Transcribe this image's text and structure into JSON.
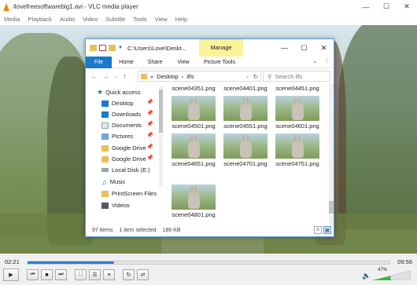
{
  "vlc": {
    "title": "ilovefreesoftwarebig1.avi - VLC media player",
    "menu": [
      "Media",
      "Playback",
      "Audio",
      "Video",
      "Subtitle",
      "Tools",
      "View",
      "Help"
    ],
    "time_elapsed": "02:21",
    "time_total": "09:56",
    "progress": 0.24,
    "volume_label": "47%",
    "volume": 0.47,
    "accent": "#2a7fd4"
  },
  "explorer": {
    "path": "C:\\Users\\Love\\Deskt...",
    "manage_tab": "Manage",
    "ribbon_tabs": [
      "File",
      "Home",
      "Share",
      "View",
      "Picture Tools"
    ],
    "breadcrumb": [
      "«",
      "Desktop",
      "›",
      "ilfs"
    ],
    "search_placeholder": "Search ilfs",
    "nav": {
      "quick_access": "Quick access",
      "items": [
        "Desktop",
        "Downloads",
        "Documents",
        "Pictures",
        "Google Drive",
        "Google Drive",
        "Local Disk (E:)",
        "Music",
        "PrintScreen Files",
        "Videos"
      ]
    },
    "files": {
      "top_row": [
        "scene04351.png",
        "scene04401.png",
        "scene04451.png"
      ],
      "row1": [
        "scene04501.png",
        "scene04551.png",
        "scene04601.png"
      ],
      "row2": [
        "scene04651.png",
        "scene04701.png",
        "scene04751.png"
      ],
      "row3": [
        "scene04801.png"
      ]
    },
    "status": {
      "count": "97 items",
      "selected": "1 item selected",
      "size": "186 KB"
    },
    "colors": {
      "file_tab": "#1979ca",
      "manage": "#faf39a"
    }
  }
}
